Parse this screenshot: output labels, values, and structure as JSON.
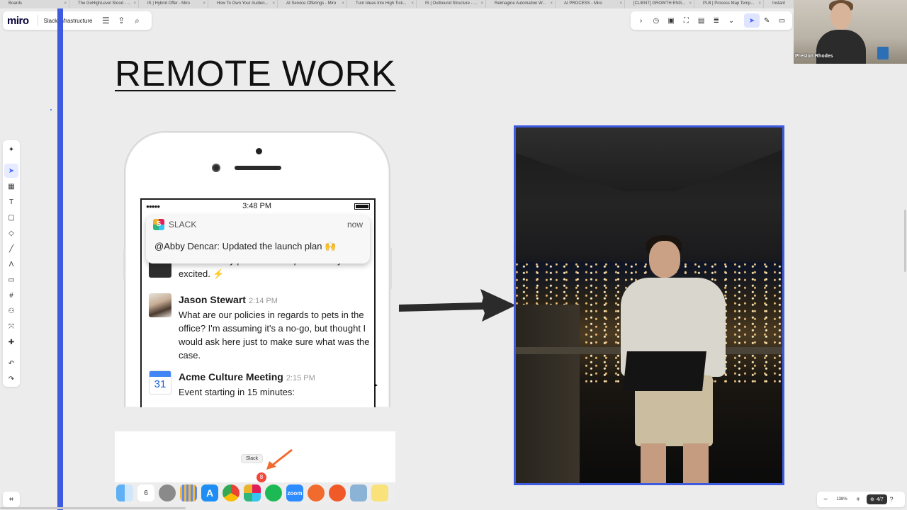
{
  "browser": {
    "tabs": [
      {
        "label": "Boards"
      },
      {
        "label": "The GoHighLevel Stood - ..."
      },
      {
        "label": "IS | Hybrid Offer - Miro"
      },
      {
        "label": "How To Own Your Audien..."
      },
      {
        "label": "AI Service Offerings - Miro"
      },
      {
        "label": "Turn Ideas Into High Tick..."
      },
      {
        "label": "IS | Outbound Structure - ..."
      },
      {
        "label": "Reimagine Automation W..."
      },
      {
        "label": "AI PROCESS - Miro"
      },
      {
        "label": "[CLIENT] GROWTH ENG..."
      },
      {
        "label": "PLB | Process Map Temp..."
      },
      {
        "label": "Instant"
      }
    ]
  },
  "header": {
    "logo": "miro",
    "board_name": "Slack Infrastructure",
    "icons": [
      "menu-icon",
      "upload-icon",
      "search-icon"
    ]
  },
  "top_right_toolbar": {
    "icons": [
      "chevron-right-icon",
      "timer-icon",
      "present-icon",
      "capture-icon",
      "sidebar-icon",
      "notes-icon",
      "chevron-down-icon",
      "cursor-icon",
      "reactions-icon",
      "comment-icon"
    ],
    "active": "cursor-icon"
  },
  "webcam": {
    "name": "Preston Rhodes"
  },
  "left_toolbar": {
    "tools": [
      "ai-sparkle-icon",
      "select-icon",
      "templates-icon",
      "text-icon",
      "sticky-note-icon",
      "shapes-icon",
      "pen-icon",
      "connector-icon",
      "comment-icon",
      "frame-icon",
      "apps-icon",
      "mindmap-icon",
      "add-icon",
      "undo-icon",
      "redo-icon"
    ],
    "active": "select-icon"
  },
  "canvas": {
    "title": "REMOTE WORK",
    "phone": {
      "status": {
        "signal": "●●●●●",
        "time": "3:48 PM"
      },
      "notification": {
        "app": "SLACK",
        "time": "now",
        "body": "@Abby Dencar: Updated the launch plan 🙌"
      },
      "messages": [
        {
          "name": "",
          "time": "",
          "text": "No! It was my pleasure! People are very excited. ⚡"
        },
        {
          "name": "Jason Stewart",
          "time": "2:14 PM",
          "text": "What are our policies in regards to pets in the office? I'm assuming it's a no-go, but thought I would ask here just to make sure what was the case."
        },
        {
          "name": "Acme Culture Meeting",
          "time": "2:15 PM",
          "text": "Event starting in 15 minutes:",
          "calendar_day": "31"
        }
      ]
    },
    "dock": {
      "tooltip": "Slack",
      "badge": "8",
      "calendar_day": "6",
      "apps": [
        "finder-icon",
        "calendar-icon",
        "settings-icon",
        "launchpad-icon",
        "app-store-icon",
        "chrome-icon",
        "slack-icon",
        "spotify-icon",
        "zoom-icon",
        "ubersuggest-icon",
        "record-icon",
        "preview-icon",
        "notes-icon"
      ],
      "zoom_label": "zoom"
    }
  },
  "zoom_controls": {
    "zoom": "138%",
    "pages": "4/7"
  },
  "colors": {
    "board_blue": "#3e5bdf",
    "miro_active": "#4262ff"
  }
}
